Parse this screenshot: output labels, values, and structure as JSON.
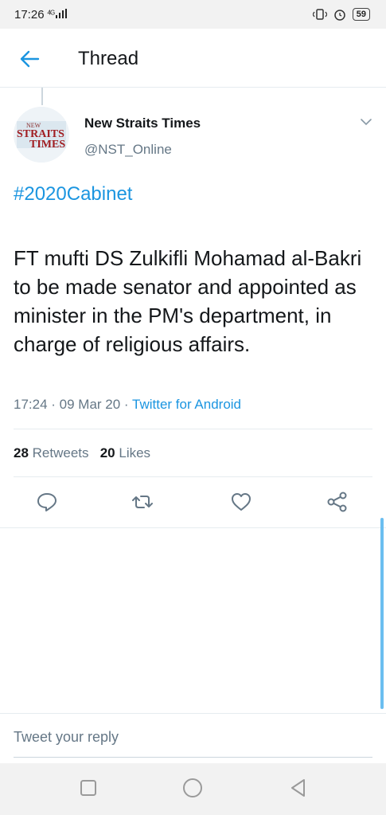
{
  "status_bar": {
    "time": "17:26",
    "network": "4G",
    "battery": "59"
  },
  "header": {
    "title": "Thread"
  },
  "tweet": {
    "author_name": "New Straits Times",
    "author_handle": "@NST_Online",
    "hashtag": "#2020Cabinet",
    "text": "FT mufti DS Zulkifli Mohamad al-Bakri to be made senator and appointed as minister in the PM's department, in charge of religious affairs.",
    "timestamp": "17:24 · 09 Mar 20 · ",
    "source": "Twitter for Android",
    "retweets_count": "28",
    "retweets_label": "Retweets",
    "likes_count": "20",
    "likes_label": "Likes"
  },
  "logo": {
    "line1": "NEW",
    "line2": "STRAITS",
    "line3": "TIMES"
  },
  "reply": {
    "placeholder": "Tweet your reply"
  },
  "icons": {
    "back": "arrow-left-icon",
    "chevron": "chevron-down-icon",
    "reply": "reply-icon",
    "retweet": "retweet-icon",
    "like": "heart-icon",
    "share": "share-icon"
  },
  "colors": {
    "accent": "#1b95e0",
    "secondary_text": "#657786",
    "divider": "#e6ecf0"
  }
}
